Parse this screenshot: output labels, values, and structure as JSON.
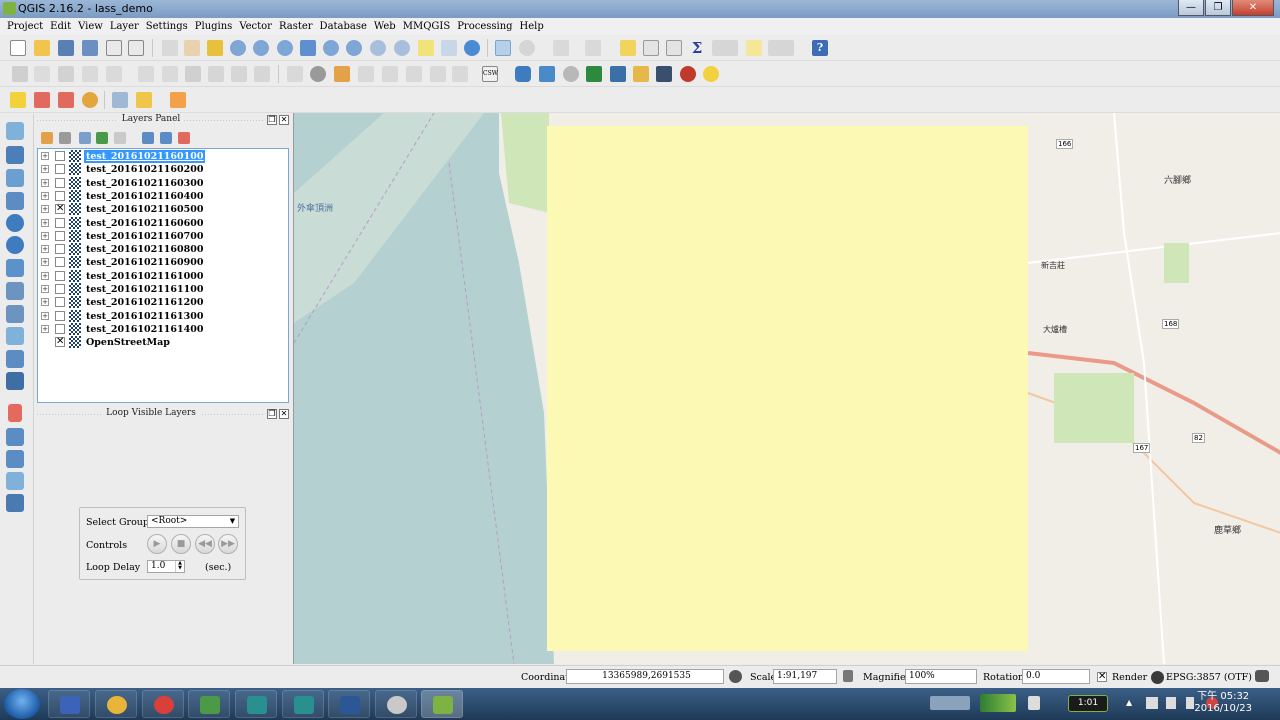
{
  "window": {
    "title": "QGIS 2.16.2 - lass_demo"
  },
  "menu": [
    "Project",
    "Edit",
    "View",
    "Layer",
    "Settings",
    "Plugins",
    "Vector",
    "Raster",
    "Database",
    "Web",
    "MMQGIS",
    "Processing",
    "Help"
  ],
  "layers_panel": {
    "title": "Layers Panel",
    "layers": [
      {
        "name": "test_20161021160100",
        "checked": false,
        "selected": true
      },
      {
        "name": "test_20161021160200",
        "checked": false
      },
      {
        "name": "test_20161021160300",
        "checked": false
      },
      {
        "name": "test_20161021160400",
        "checked": false
      },
      {
        "name": "test_20161021160500",
        "checked": true
      },
      {
        "name": "test_20161021160600",
        "checked": false
      },
      {
        "name": "test_20161021160700",
        "checked": false
      },
      {
        "name": "test_20161021160800",
        "checked": false
      },
      {
        "name": "test_20161021160900",
        "checked": false
      },
      {
        "name": "test_20161021161000",
        "checked": false
      },
      {
        "name": "test_20161021161100",
        "checked": false
      },
      {
        "name": "test_20161021161200",
        "checked": false
      },
      {
        "name": "test_20161021161300",
        "checked": false
      },
      {
        "name": "test_20161021161400",
        "checked": false
      },
      {
        "name": "OpenStreetMap",
        "checked": true
      }
    ]
  },
  "loop_panel": {
    "title": "Loop Visible Layers",
    "select_group_label": "Select Group",
    "select_group_value": "<Root>",
    "controls_label": "Controls",
    "loop_delay_label": "Loop Delay",
    "loop_delay_value": "1.0",
    "loop_delay_unit": "(sec.)"
  },
  "map_labels": {
    "place_1": "外傘頂洲",
    "place_2": "六腳鄉",
    "place_3": "新吉莊",
    "place_4": "大爐槽",
    "place_5": "鹿草鄉",
    "road_1": "166",
    "road_2": "168",
    "road_3": "167",
    "road_4": "82"
  },
  "statusbar": {
    "coordinate_label": "Coordinate",
    "coordinate_value": "13365989,2691535",
    "scale_label": "Scale",
    "scale_value": "1:91,197",
    "magnifier_label": "Magnifier",
    "magnifier_value": "100%",
    "rotation_label": "Rotation",
    "rotation_value": "0.0",
    "render_label": "Render",
    "crs_label": "EPSG:3857 (OTF)"
  },
  "taskbar": {
    "time": "下午 05:32",
    "date": "2016/10/23",
    "tray_badge": "1:01"
  }
}
